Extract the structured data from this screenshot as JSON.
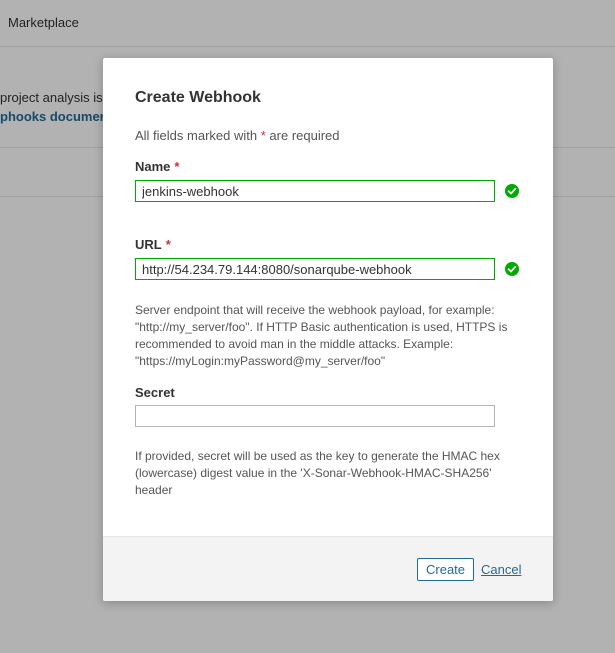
{
  "background": {
    "nav_item": "Marketplace",
    "text_line1": "project analysis is c",
    "text_line2": "phooks documenta"
  },
  "modal": {
    "title": "Create Webhook",
    "required_note_prefix": "All fields marked with",
    "required_star": "*",
    "required_note_suffix": "are required",
    "fields": {
      "name": {
        "label": "Name",
        "value": "jenkins-webhook",
        "valid": true
      },
      "url": {
        "label": "URL",
        "value": "http://54.234.79.144:8080/sonarqube-webhook",
        "valid": true,
        "help": "Server endpoint that will receive the webhook payload, for example: \"http://my_server/foo\". If HTTP Basic authentication is used, HTTPS is recommended to avoid man in the middle attacks. Example: \"https://myLogin:myPassword@my_server/foo\""
      },
      "secret": {
        "label": "Secret",
        "value": "",
        "help": "If provided, secret will be used as the key to generate the HMAC hex (lowercase) digest value in the 'X-Sonar-Webhook-HMAC-SHA256' header"
      }
    },
    "footer": {
      "create_label": "Create",
      "cancel_label": "Cancel"
    }
  },
  "colors": {
    "valid": "#00aa00",
    "link": "#236a97",
    "required": "#d02f3a"
  },
  "icons": {
    "valid": "check-circle-icon"
  }
}
